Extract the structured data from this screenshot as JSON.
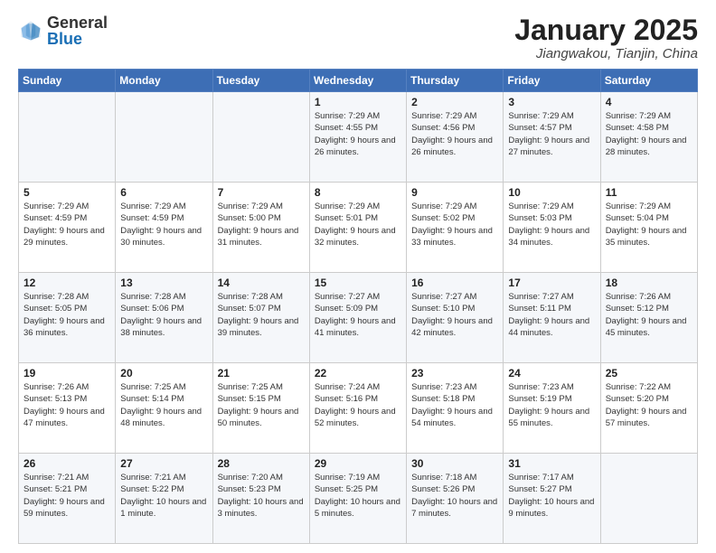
{
  "header": {
    "logo_general": "General",
    "logo_blue": "Blue",
    "title": "January 2025",
    "location": "Jiangwakou, Tianjin, China"
  },
  "weekdays": [
    "Sunday",
    "Monday",
    "Tuesday",
    "Wednesday",
    "Thursday",
    "Friday",
    "Saturday"
  ],
  "weeks": [
    [
      {
        "day": "",
        "info": ""
      },
      {
        "day": "",
        "info": ""
      },
      {
        "day": "",
        "info": ""
      },
      {
        "day": "1",
        "info": "Sunrise: 7:29 AM\nSunset: 4:55 PM\nDaylight: 9 hours and 26 minutes."
      },
      {
        "day": "2",
        "info": "Sunrise: 7:29 AM\nSunset: 4:56 PM\nDaylight: 9 hours and 26 minutes."
      },
      {
        "day": "3",
        "info": "Sunrise: 7:29 AM\nSunset: 4:57 PM\nDaylight: 9 hours and 27 minutes."
      },
      {
        "day": "4",
        "info": "Sunrise: 7:29 AM\nSunset: 4:58 PM\nDaylight: 9 hours and 28 minutes."
      }
    ],
    [
      {
        "day": "5",
        "info": "Sunrise: 7:29 AM\nSunset: 4:59 PM\nDaylight: 9 hours and 29 minutes."
      },
      {
        "day": "6",
        "info": "Sunrise: 7:29 AM\nSunset: 4:59 PM\nDaylight: 9 hours and 30 minutes."
      },
      {
        "day": "7",
        "info": "Sunrise: 7:29 AM\nSunset: 5:00 PM\nDaylight: 9 hours and 31 minutes."
      },
      {
        "day": "8",
        "info": "Sunrise: 7:29 AM\nSunset: 5:01 PM\nDaylight: 9 hours and 32 minutes."
      },
      {
        "day": "9",
        "info": "Sunrise: 7:29 AM\nSunset: 5:02 PM\nDaylight: 9 hours and 33 minutes."
      },
      {
        "day": "10",
        "info": "Sunrise: 7:29 AM\nSunset: 5:03 PM\nDaylight: 9 hours and 34 minutes."
      },
      {
        "day": "11",
        "info": "Sunrise: 7:29 AM\nSunset: 5:04 PM\nDaylight: 9 hours and 35 minutes."
      }
    ],
    [
      {
        "day": "12",
        "info": "Sunrise: 7:28 AM\nSunset: 5:05 PM\nDaylight: 9 hours and 36 minutes."
      },
      {
        "day": "13",
        "info": "Sunrise: 7:28 AM\nSunset: 5:06 PM\nDaylight: 9 hours and 38 minutes."
      },
      {
        "day": "14",
        "info": "Sunrise: 7:28 AM\nSunset: 5:07 PM\nDaylight: 9 hours and 39 minutes."
      },
      {
        "day": "15",
        "info": "Sunrise: 7:27 AM\nSunset: 5:09 PM\nDaylight: 9 hours and 41 minutes."
      },
      {
        "day": "16",
        "info": "Sunrise: 7:27 AM\nSunset: 5:10 PM\nDaylight: 9 hours and 42 minutes."
      },
      {
        "day": "17",
        "info": "Sunrise: 7:27 AM\nSunset: 5:11 PM\nDaylight: 9 hours and 44 minutes."
      },
      {
        "day": "18",
        "info": "Sunrise: 7:26 AM\nSunset: 5:12 PM\nDaylight: 9 hours and 45 minutes."
      }
    ],
    [
      {
        "day": "19",
        "info": "Sunrise: 7:26 AM\nSunset: 5:13 PM\nDaylight: 9 hours and 47 minutes."
      },
      {
        "day": "20",
        "info": "Sunrise: 7:25 AM\nSunset: 5:14 PM\nDaylight: 9 hours and 48 minutes."
      },
      {
        "day": "21",
        "info": "Sunrise: 7:25 AM\nSunset: 5:15 PM\nDaylight: 9 hours and 50 minutes."
      },
      {
        "day": "22",
        "info": "Sunrise: 7:24 AM\nSunset: 5:16 PM\nDaylight: 9 hours and 52 minutes."
      },
      {
        "day": "23",
        "info": "Sunrise: 7:23 AM\nSunset: 5:18 PM\nDaylight: 9 hours and 54 minutes."
      },
      {
        "day": "24",
        "info": "Sunrise: 7:23 AM\nSunset: 5:19 PM\nDaylight: 9 hours and 55 minutes."
      },
      {
        "day": "25",
        "info": "Sunrise: 7:22 AM\nSunset: 5:20 PM\nDaylight: 9 hours and 57 minutes."
      }
    ],
    [
      {
        "day": "26",
        "info": "Sunrise: 7:21 AM\nSunset: 5:21 PM\nDaylight: 9 hours and 59 minutes."
      },
      {
        "day": "27",
        "info": "Sunrise: 7:21 AM\nSunset: 5:22 PM\nDaylight: 10 hours and 1 minute."
      },
      {
        "day": "28",
        "info": "Sunrise: 7:20 AM\nSunset: 5:23 PM\nDaylight: 10 hours and 3 minutes."
      },
      {
        "day": "29",
        "info": "Sunrise: 7:19 AM\nSunset: 5:25 PM\nDaylight: 10 hours and 5 minutes."
      },
      {
        "day": "30",
        "info": "Sunrise: 7:18 AM\nSunset: 5:26 PM\nDaylight: 10 hours and 7 minutes."
      },
      {
        "day": "31",
        "info": "Sunrise: 7:17 AM\nSunset: 5:27 PM\nDaylight: 10 hours and 9 minutes."
      },
      {
        "day": "",
        "info": ""
      }
    ]
  ]
}
